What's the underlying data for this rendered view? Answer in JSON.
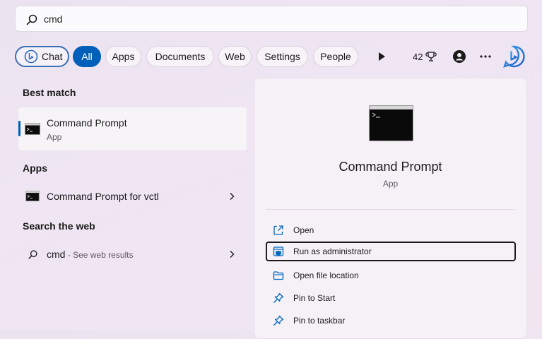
{
  "search": {
    "query": "cmd"
  },
  "filters": {
    "chat_label": "Chat",
    "tabs": [
      "All",
      "Apps",
      "Documents",
      "Web",
      "Settings",
      "People"
    ],
    "active_tab": "All",
    "rewards_points": "42"
  },
  "icons": {
    "search": "search-icon",
    "bing": "bing-icon",
    "play": "play-icon",
    "trophy": "trophy-icon",
    "avatar": "avatar-icon",
    "more": "more-icon",
    "cmd": "command-prompt-icon",
    "chevron": "chevron-right-icon",
    "open": "open-icon",
    "admin": "shield-icon",
    "folder": "folder-icon",
    "pin": "pin-icon"
  },
  "left": {
    "best_match_heading": "Best match",
    "best_match": {
      "title": "Command Prompt",
      "subtitle": "App"
    },
    "apps_heading": "Apps",
    "apps": [
      {
        "title": "Command Prompt for vctl"
      }
    ],
    "web_heading": "Search the web",
    "web": {
      "query": "cmd",
      "suffix": " - See web results"
    }
  },
  "right": {
    "title": "Command Prompt",
    "subtitle": "App",
    "actions": [
      "Open",
      "Run as administrator",
      "Open file location",
      "Pin to Start",
      "Pin to taskbar"
    ]
  },
  "colors": {
    "accent": "#005fb8",
    "chat_border": "#3a6fb5"
  }
}
